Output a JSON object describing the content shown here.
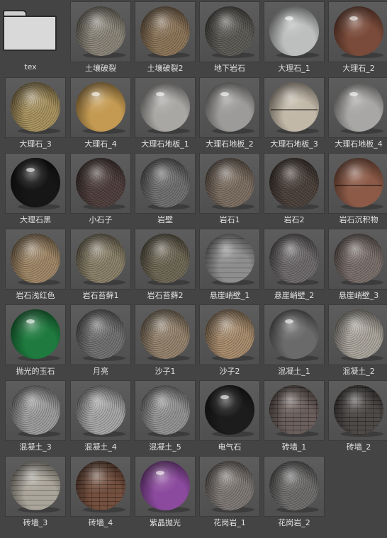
{
  "folder": {
    "label": "tex",
    "icon": "folder-icon"
  },
  "materials": [
    {
      "label": "土壤破裂",
      "color": "#8a8578",
      "style": "tex"
    },
    {
      "label": "土壤破裂2",
      "color": "#8c7458",
      "style": "tex"
    },
    {
      "label": "地下岩石",
      "color": "#5c5a55",
      "style": "tex"
    },
    {
      "label": "大理石_1",
      "color": "#bdbebe",
      "style": "gloss"
    },
    {
      "label": "大理石_2",
      "color": "#7a4b3a",
      "style": "gloss"
    },
    {
      "label": "大理石_3",
      "color": "#a8925e",
      "style": "tex"
    },
    {
      "label": "大理石_4",
      "color": "#c49a52",
      "style": "gloss"
    },
    {
      "label": "大理石地板_1",
      "color": "#a9a7a4",
      "style": "gloss"
    },
    {
      "label": "大理石地板_2",
      "color": "#9c9b99",
      "style": "gloss"
    },
    {
      "label": "大理石地板_3",
      "color": "#c2b8a8",
      "style": "seam"
    },
    {
      "label": "大理石地板_4",
      "color": "#a8a7a5",
      "style": "gloss"
    },
    {
      "label": "大理石黑",
      "color": "#161616",
      "style": "gloss"
    },
    {
      "label": "小石子",
      "color": "#4e3e3c",
      "style": "tex"
    },
    {
      "label": "岩壁",
      "color": "#6f6f70",
      "style": "tex"
    },
    {
      "label": "岩石1",
      "color": "#7c6e61",
      "style": "tex"
    },
    {
      "label": "岩石2",
      "color": "#4b403a",
      "style": "tex"
    },
    {
      "label": "岩石沉积物",
      "color": "#8c5a47",
      "style": "seam"
    },
    {
      "label": "岩石浅红色",
      "color": "#a08766",
      "style": "tex"
    },
    {
      "label": "岩石苔藓1",
      "color": "#8a8068",
      "style": "tex"
    },
    {
      "label": "岩石苔藓2",
      "color": "#6e6755",
      "style": "tex"
    },
    {
      "label": "悬崖峭壁_1",
      "color": "#8e8e8e",
      "style": "bands"
    },
    {
      "label": "悬崖峭壁_2",
      "color": "#6e6a6c",
      "style": "tex"
    },
    {
      "label": "悬崖峭壁_3",
      "color": "#7a6e6a",
      "style": "tex"
    },
    {
      "label": "抛光的玉石",
      "color": "#1e7a3e",
      "style": "gloss"
    },
    {
      "label": "月亮",
      "color": "#707070",
      "style": "tex"
    },
    {
      "label": "沙子1",
      "color": "#94826c",
      "style": "tex"
    },
    {
      "label": "沙子2",
      "color": "#a88c6c",
      "style": "tex"
    },
    {
      "label": "混凝土_1",
      "color": "#6a6a6a",
      "style": "gloss"
    },
    {
      "label": "混凝土_2",
      "color": "#aaa59c",
      "style": "tex"
    },
    {
      "label": "混凝土_3",
      "color": "#9c9c9c",
      "style": "tex"
    },
    {
      "label": "混凝土_4",
      "color": "#a6a6a6",
      "style": "tex"
    },
    {
      "label": "混凝土_5",
      "color": "#939393",
      "style": "tex"
    },
    {
      "label": "电气石",
      "color": "#1c1c1c",
      "style": "gloss"
    },
    {
      "label": "砖墙_1",
      "color": "#6b5f5c",
      "style": "bricks"
    },
    {
      "label": "砖墙_2",
      "color": "#4e4a48",
      "style": "bricks"
    },
    {
      "label": "砖墙_3",
      "color": "#aaa59a",
      "style": "bands"
    },
    {
      "label": "砖墙_4",
      "color": "#74503f",
      "style": "bricks"
    },
    {
      "label": "紫晶抛光",
      "color": "#8c4a9e",
      "style": "gloss"
    },
    {
      "label": "花岗岩_1",
      "color": "#7e7874",
      "style": "tex"
    },
    {
      "label": "花岗岩_2",
      "color": "#6e6d6c",
      "style": "tex"
    }
  ]
}
